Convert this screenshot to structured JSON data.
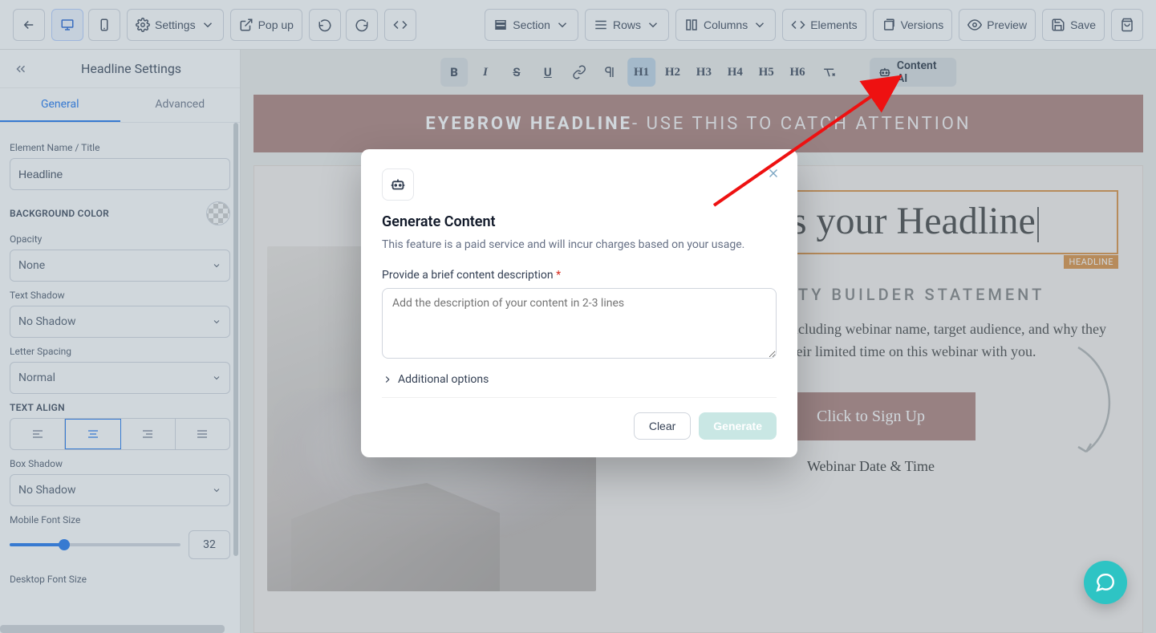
{
  "toolbar": {
    "settings": "Settings",
    "popup": "Pop up",
    "section": "Section",
    "rows": "Rows",
    "columns": "Columns",
    "elements": "Elements",
    "versions": "Versions",
    "preview": "Preview",
    "save": "Save"
  },
  "sidebar": {
    "title": "Headline Settings",
    "tab_general": "General",
    "tab_advanced": "Advanced",
    "element_name_label": "Element Name / Title",
    "element_name_value": "Headline",
    "bg_label": "BACKGROUND COLOR",
    "opacity_label": "Opacity",
    "opacity_value": "None",
    "text_shadow_label": "Text Shadow",
    "text_shadow_value": "No Shadow",
    "letter_spacing_label": "Letter Spacing",
    "letter_spacing_value": "Normal",
    "text_align_label": "TEXT ALIGN",
    "box_shadow_label": "Box Shadow",
    "box_shadow_value": "No Shadow",
    "mobile_font_label": "Mobile Font Size",
    "mobile_font_value": "32",
    "desktop_font_label": "Desktop Font Size"
  },
  "format": {
    "content_ai": "Content AI",
    "h1": "H1",
    "h2": "H2",
    "h3": "H3",
    "h4": "H4",
    "h5": "H5",
    "h6": "H6"
  },
  "canvas": {
    "eyebrow_bold": "EYEBROW HEADLINE",
    "eyebrow_rest": " - USE THIS TO CATCH ATTENTION",
    "headline_line": "This is your Headline",
    "headline_tag": "HEADLINE",
    "credibility": "CREDIBILITY BUILDER STATEMENT",
    "body": "Supporting text goes here including webinar name, target audience, and why they should spend their limited time on this webinar with you.",
    "cta": "Click to Sign Up",
    "datetime": "Webinar Date & Time"
  },
  "modal": {
    "title": "Generate Content",
    "sub": "This feature is a paid service and will incur charges based on your usage.",
    "prompt_label": "Provide a brief content description",
    "placeholder": "Add the description of your content in 2-3 lines",
    "additional": "Additional options",
    "clear": "Clear",
    "generate": "Generate"
  }
}
